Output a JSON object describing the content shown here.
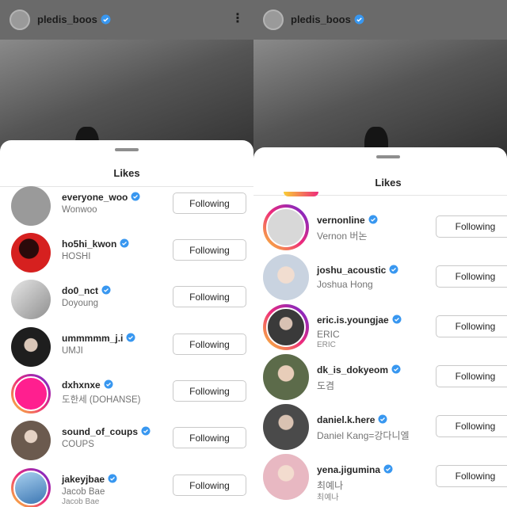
{
  "colors": {
    "verified": "#3897f0",
    "button_border": "#c9c9c9",
    "sheet": "#ffffff",
    "dimmed_bg": "#5e5e5e"
  },
  "panels": [
    {
      "header": {
        "username": "pledis_boos",
        "more_icon": "⋮"
      },
      "sheet_title": "Likes",
      "users": [
        {
          "username": "everyone_woo",
          "name": "Wonwoo",
          "button": "Following",
          "avatar_color": "#9a9a9a"
        },
        {
          "username": "ho5hi_kwon",
          "name": "HOSHI",
          "button": "Following",
          "avatar_color": "#d6201f"
        },
        {
          "username": "do0_nct",
          "name": "Doyoung",
          "button": "Following",
          "avatar_color": "#c7c7c7"
        },
        {
          "username": "ummmmm_j.i",
          "name": "UMJI",
          "button": "Following",
          "avatar_color": "#2b2b2b"
        },
        {
          "username": "dxhxnxe",
          "name": "도한세 (DOHANSE)",
          "button": "Following",
          "avatar_color": "#ff1f8f"
        },
        {
          "username": "sound_of_coups",
          "name": "COUPS",
          "button": "Following",
          "avatar_color": "#6b5a4e"
        },
        {
          "username": "jakeyjbae",
          "name": "Jacob Bae",
          "subname": "Jacob Bae",
          "button": "Following",
          "avatar_color": "#6aa6d8"
        }
      ]
    },
    {
      "header": {
        "username": "pledis_boos"
      },
      "sheet_title": "Likes",
      "users": [
        {
          "username": "vernonline",
          "name": "Vernon 버논",
          "button": "Following",
          "avatar_color": "#d8d8d8"
        },
        {
          "username": "joshu_acoustic",
          "name": "Joshua Hong",
          "button": "Following",
          "avatar_color": "#c9d3e0"
        },
        {
          "username": "eric.is.youngjae",
          "name": "ERIC",
          "subname": "ERIC",
          "button": "Following",
          "avatar_color": "#3a3a3a"
        },
        {
          "username": "dk_is_dokyeom",
          "name": "도겸",
          "button": "Following",
          "avatar_color": "#5c6b4a"
        },
        {
          "username": "daniel.k.here",
          "name": "Daniel Kang=강다니엘",
          "button": "Following",
          "avatar_color": "#4a4a4a"
        },
        {
          "username": "yena.jigumina",
          "name": "최예나",
          "subname": "최예나",
          "button": "Following",
          "avatar_color": "#e8b8c2"
        }
      ]
    }
  ]
}
